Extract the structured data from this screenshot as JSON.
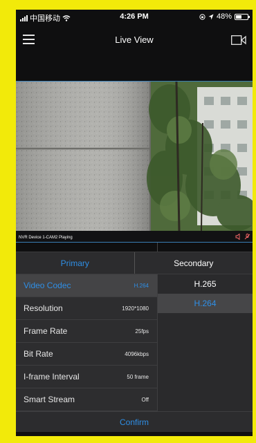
{
  "status_bar": {
    "carrier": "中国移动",
    "time": "4:26 PM",
    "battery": "48%",
    "battery_level": 0.48
  },
  "navbar": {
    "title": "Live View"
  },
  "video": {
    "caption": "NVR Device 1-CAM2 Playing"
  },
  "tabs": {
    "primary": "Primary",
    "secondary": "Secondary"
  },
  "settings": [
    {
      "label": "Video Codec",
      "value": "H.264"
    },
    {
      "label": "Resolution",
      "value": "1920*1080"
    },
    {
      "label": "Frame Rate",
      "value": "25fps"
    },
    {
      "label": "Bit Rate",
      "value": "4096kbps"
    },
    {
      "label": "I-frame Interval",
      "value": "50 frame"
    },
    {
      "label": "Smart Stream",
      "value": "Off"
    }
  ],
  "codec_options": [
    "H.265",
    "H.264"
  ],
  "confirm_label": "Confirm",
  "colors": {
    "accent": "#2f8fe6",
    "frame": "#f2ea0a",
    "panel": "#2d2d2f"
  },
  "icons": [
    "wifi-icon",
    "signal-icon",
    "lock-rotation-icon",
    "location-icon",
    "battery-icon",
    "menu-icon",
    "camera-icon",
    "mute-icon",
    "mic-off-icon"
  ]
}
